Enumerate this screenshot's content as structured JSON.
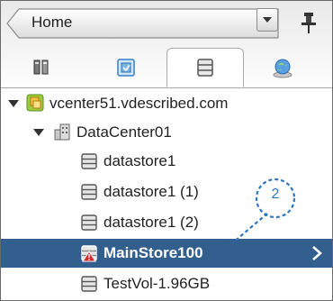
{
  "header": {
    "home_label": "Home"
  },
  "tabs": [
    {
      "icon": "hosts-clusters-icon",
      "active": false
    },
    {
      "icon": "vms-templates-icon",
      "active": false
    },
    {
      "icon": "storage-icon",
      "active": true
    },
    {
      "icon": "networking-icon",
      "active": false
    }
  ],
  "tree": {
    "vcenter": "vcenter51.vdescribed.com",
    "datacenter": "DataCenter01",
    "items": [
      {
        "label": "datastore1",
        "selected": false
      },
      {
        "label": "datastore1 (1)",
        "selected": false
      },
      {
        "label": "datastore1 (2)",
        "selected": false
      },
      {
        "label": "MainStore100",
        "selected": true,
        "alert": true
      },
      {
        "label": "TestVol-1.96GB",
        "selected": false
      }
    ]
  },
  "annotation": {
    "number": "2"
  },
  "colors": {
    "selection": "#335f8f",
    "annotation": "#2f75c2"
  }
}
